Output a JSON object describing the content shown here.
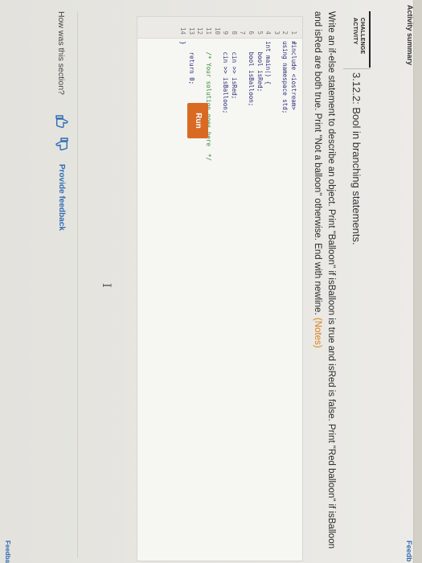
{
  "header": {
    "feedback_top": "Feedb",
    "side_label": "Activity summary"
  },
  "activity": {
    "badge_line1": "CHALLENGE",
    "badge_line2": "ACTIVITY",
    "title": "3.12.2: Bool in branching statements.",
    "description_main": "Write an if-else statement to describe an object. Print \"Balloon\" if isBalloon is true and isRed is false. Print \"Red balloon\" if isBalloon and isRed are both true. Print \"Not a balloon\" otherwise. End with newline.",
    "notes_link": "(Notes)"
  },
  "editor": {
    "lines": [
      {
        "n": "1",
        "text": "#include <iostream>"
      },
      {
        "n": "2",
        "text": "using namespace std;"
      },
      {
        "n": "3",
        "text": ""
      },
      {
        "n": "4",
        "text": "int main() {"
      },
      {
        "n": "5",
        "text": "   bool isRed;"
      },
      {
        "n": "6",
        "text": "   bool isBalloon;"
      },
      {
        "n": "7",
        "text": ""
      },
      {
        "n": "8",
        "text": "   cin >> isRed;"
      },
      {
        "n": "9",
        "text": "   cin >> isBalloon;"
      },
      {
        "n": "10",
        "text": ""
      },
      {
        "n": "11",
        "text": "   /* Your solution goes here  */"
      },
      {
        "n": "12",
        "text": ""
      },
      {
        "n": "13",
        "text": "   return 0;"
      },
      {
        "n": "14",
        "text": "}"
      }
    ]
  },
  "run_button": {
    "label": "Run"
  },
  "feedback": {
    "question": "How was this section?",
    "provide_label": "Provide feedback",
    "feedback_bottom": "Feedbac",
    "thumbs_up_icon": "thumbs-up-icon",
    "thumbs_down_icon": "thumbs-down-icon"
  },
  "colors": {
    "accent": "#d96a24",
    "link": "#2f6db5"
  }
}
